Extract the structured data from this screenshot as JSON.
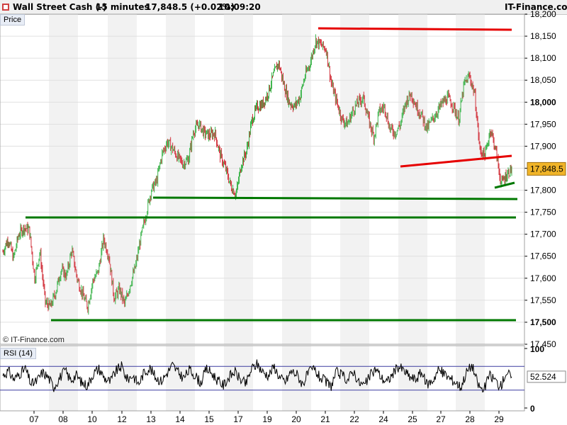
{
  "header": {
    "instrument": "Wall Street Cash (-)",
    "timeframe": "15 minutes",
    "quote": "17,848.5 (+0.02%)",
    "time": "10:09:20",
    "brand": "IT-Finance.com"
  },
  "panels": {
    "price_label": "Price",
    "rsi_label": "RSI (14)",
    "copyright": "© IT-Finance.com"
  },
  "colors": {
    "up": "#3cb44b",
    "down": "#d2323c",
    "resistance": "#e60000",
    "support": "#007800",
    "rsi_line": "#000000",
    "rsi_band": "#3c3ca0",
    "price_tag_bg": "#f0b428"
  },
  "chart_data": [
    {
      "type": "line",
      "series_style": "ohlc-bars",
      "y_axis_position": "right",
      "ylim": [
        17450,
        18200
      ],
      "yticks": [
        17450,
        17500,
        17550,
        17600,
        17650,
        17700,
        17750,
        17800,
        17850,
        17900,
        17950,
        18000,
        18050,
        18100,
        18150,
        18200
      ],
      "ytick_labels": [
        "17,450",
        "17,500",
        "17,550",
        "17,600",
        "17,650",
        "17,700",
        "17,750",
        "17,800",
        "17,850",
        "17,900",
        "17,950",
        "18,000",
        "18,050",
        "18,100",
        "18,150",
        "18,200"
      ],
      "bold_ticks": [
        17500,
        18000
      ],
      "last_price": 17848.5,
      "last_price_label": "17,848.5",
      "x_days": [
        "07",
        "08",
        "10",
        "12",
        "13",
        "14",
        "15",
        "17",
        "19",
        "20",
        "21",
        "22",
        "24",
        "25",
        "27",
        "28",
        "29"
      ],
      "series": [
        {
          "values": [
            17660,
            17690,
            17645,
            17700,
            17715,
            17710,
            17600,
            17660,
            17545,
            17535,
            17570,
            17620,
            17605,
            17665,
            17600,
            17565,
            17535,
            17595,
            17615,
            17690,
            17650,
            17555,
            17575,
            17540,
            17585,
            17625,
            17690,
            17745,
            17800,
            17820,
            17880,
            17910,
            17895,
            17875,
            17860,
            17870,
            17935,
            17950,
            17930,
            17925,
            17930,
            17880,
            17850,
            17810,
            17790,
            17860,
            17890,
            17960,
            17990,
            17995,
            18020,
            18060,
            18090,
            18040,
            18000,
            17990,
            18010,
            18060,
            18090,
            18140,
            18130,
            18120,
            18040,
            18000,
            17960,
            17950,
            17980,
            18000,
            18010,
            17960,
            17920,
            17980,
            17990,
            17940,
            17930,
            17950,
            18000,
            18020,
            17990,
            17970,
            17940,
            17960,
            17980,
            18000,
            18010,
            17990,
            17960,
            18040,
            18060,
            18020,
            17890,
            17880,
            17940,
            17890,
            17815,
            17835,
            17848.5
          ]
        }
      ],
      "lines": [
        {
          "kind": "resistance",
          "from": [
            0,
            18172
          ],
          "to": [
            1,
            18170
          ]
        },
        {
          "kind": "resistance",
          "from": [
            0,
            17853
          ],
          "to": [
            1,
            17873
          ]
        },
        {
          "kind": "support",
          "from": [
            0,
            17733
          ],
          "to": [
            1,
            17733
          ]
        },
        {
          "kind": "support",
          "from": [
            0,
            17778
          ],
          "to": [
            1,
            17775
          ]
        },
        {
          "kind": "support",
          "from": [
            0,
            17500
          ],
          "to": [
            1,
            17499
          ]
        },
        {
          "kind": "support",
          "from": [
            0,
            17800
          ],
          "to": [
            1,
            17810
          ]
        }
      ]
    },
    {
      "type": "line",
      "title": "RSI (14)",
      "ylim": [
        0,
        100
      ],
      "yticks": [
        0,
        100
      ],
      "ytick_labels": [
        "0",
        "100"
      ],
      "bands": [
        30,
        70
      ],
      "last_value": 52.524,
      "last_value_label": "52.524",
      "series": [
        {
          "values": [
            55,
            62,
            48,
            58,
            66,
            40,
            45,
            60,
            52,
            35,
            50,
            63,
            47,
            55,
            42,
            38,
            58,
            66,
            50,
            44,
            62,
            70,
            48,
            55,
            40,
            60,
            67,
            52,
            45,
            58,
            72,
            60,
            50,
            64,
            55,
            42,
            66,
            58,
            46,
            38,
            52,
            61,
            48,
            40,
            66,
            74,
            60,
            55,
            70,
            50,
            44,
            62,
            57,
            40,
            58,
            66,
            52,
            45,
            36,
            60,
            55,
            47,
            63,
            42,
            38,
            55,
            66,
            50,
            44,
            58,
            70,
            62,
            52,
            48,
            60,
            40,
            46,
            64,
            58,
            50,
            44,
            35,
            60,
            72,
            40,
            28,
            55,
            48,
            35,
            60,
            52.524
          ]
        }
      ]
    }
  ]
}
